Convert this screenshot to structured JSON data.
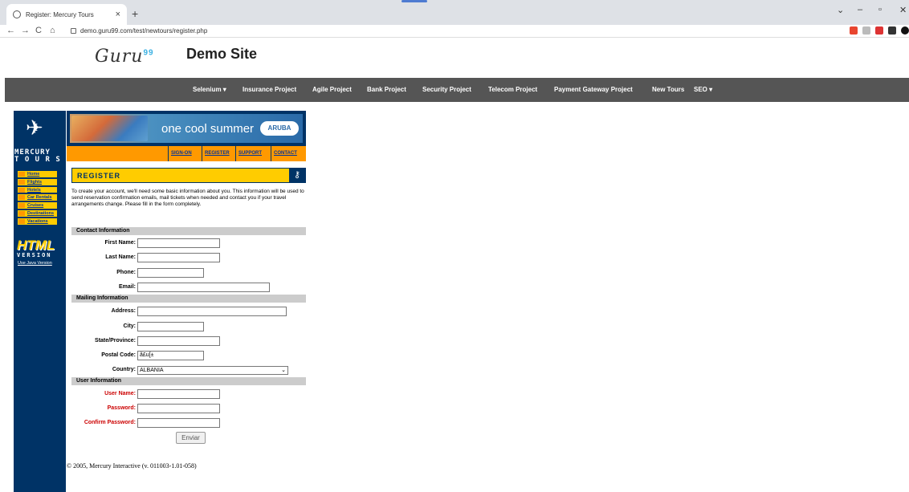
{
  "browser": {
    "tab_title": "Register: Mercury Tours",
    "tab_close": "×",
    "new_tab": "+",
    "url": "demo.guru99.com/test/newtours/register.php",
    "back": "←",
    "forward": "→",
    "reload": "C",
    "home": "⌂",
    "win_min": "–",
    "win_restore": "▫",
    "win_close": "✕",
    "tabs_menu": "⌄"
  },
  "guru99": {
    "logo": "Guru",
    "logo_sup": "99",
    "title": "Demo Site",
    "menu": [
      "Selenium ▾",
      "Insurance Project",
      "Agile Project",
      "Bank Project",
      "Security Project",
      "Telecom Project",
      "Payment Gateway Project",
      "New Tours",
      "SEO ▾"
    ]
  },
  "mercury": {
    "brand_top": "MERCURY",
    "brand_bottom": "T O U R S",
    "nav": [
      "Home",
      "Flights",
      "Hotels",
      "Car Rentals",
      "Cruises",
      "Destinations",
      "Vacations"
    ],
    "html_logo": "HTML",
    "html_version": "VERSION",
    "java_link": "Use Java Version",
    "banner_text": "one cool summer",
    "banner_brand": "ARUBA",
    "top_links": [
      "SIGN-ON",
      "REGISTER",
      "SUPPORT",
      "CONTACT"
    ],
    "register_title": "REGISTER",
    "intro": "To create your account, we'll need some basic information about you. This information will be used to send reservation confirmation emails, mail tickets when needed and contact you if your travel arrangements change. Please fill in the form completely.",
    "contact_section": "Contact Information",
    "mailing_section": "Mailing Information",
    "user_section": "User Information",
    "labels": {
      "first_name": "First Name:",
      "last_name": "Last Name:",
      "phone": "Phone:",
      "email": "Email:",
      "address": "Address:",
      "city": "City:",
      "state": "State/Province:",
      "postal": "Postal Code:",
      "country": "Country:",
      "username": "User Name:",
      "password": "Password:",
      "confirm": "Confirm Password:"
    },
    "values": {
      "first_name": "",
      "last_name": "",
      "phone": "",
      "email": "",
      "address": "",
      "city": "",
      "state": "",
      "postal": "ã£u[±",
      "country": "ALBANIA",
      "username": "",
      "password": "",
      "confirm": ""
    },
    "submit_label": "Enviar",
    "footer": "© 2005, Mercury Interactive (v. 011003-1.01-058)"
  },
  "colors": {
    "nav_bg": "#003366",
    "accent_yellow": "#ffcc00",
    "accent_orange": "#ff9900",
    "menu_bar": "#555555",
    "required_label": "#cc0000"
  }
}
